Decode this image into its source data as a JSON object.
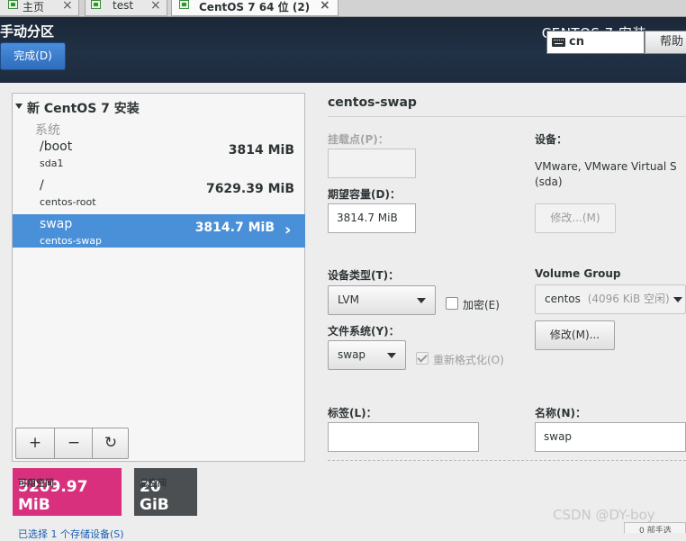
{
  "vm_tabs": [
    {
      "label": "主页",
      "close": "×"
    },
    {
      "label": "test",
      "close": "×"
    },
    {
      "label": "CentOS 7 64 位 (2)",
      "close": "×"
    }
  ],
  "header": {
    "title": "手动分区",
    "done_label": "完成(D)",
    "product": "CENTOS 7 安装",
    "keyboard_layout": "cn",
    "help_label": "帮助"
  },
  "left": {
    "install_title": "新 CentOS 7 安装",
    "system_label": "系统",
    "partitions": [
      {
        "mount": "/boot",
        "device": "sda1",
        "size": "3814 MiB"
      },
      {
        "mount": "/",
        "device": "centos-root",
        "size": "7629.39 MiB"
      },
      {
        "mount": "swap",
        "device": "centos-swap",
        "size": "3814.7 MiB"
      }
    ],
    "toolbar": {
      "add": "+",
      "remove": "−",
      "refresh": "↻"
    }
  },
  "space": {
    "available_label": "可用空间",
    "available_value": "5209.97 MiB",
    "total_label": "总空间",
    "total_value": "20 GiB"
  },
  "footer_link": "已选择 1 个存储设备(S)",
  "detail": {
    "title": "centos-swap",
    "mount_label": "挂载点(P)：",
    "mount_value": "",
    "capacity_label": "期望容量(D)：",
    "capacity_value": "3814.7 MiB",
    "device_label": "设备：",
    "device_value": "VMware, VMware Virtual S (sda)",
    "device_modify": "修改...(M)",
    "device_type_label": "设备类型(T)：",
    "device_type_value": "LVM",
    "encrypt_label": "加密(E)",
    "vg_label": "Volume Group",
    "vg_value": "centos",
    "vg_free": "(4096 KiB 空闲)",
    "vg_modify": "修改(M)...",
    "fs_label": "文件系统(Y)：",
    "fs_value": "swap",
    "reformat_label": "重新格式化(O)",
    "tag_label": "标签(L)：",
    "tag_value": "",
    "name_label": "名称(N)：",
    "name_value": "swap"
  },
  "corner_button": "0 部手选",
  "watermark": "CSDN @DY-boy",
  "colors": {
    "header": "#213146",
    "selection": "#4a90d9",
    "available": "#d9307e",
    "total": "#4b4f52"
  }
}
